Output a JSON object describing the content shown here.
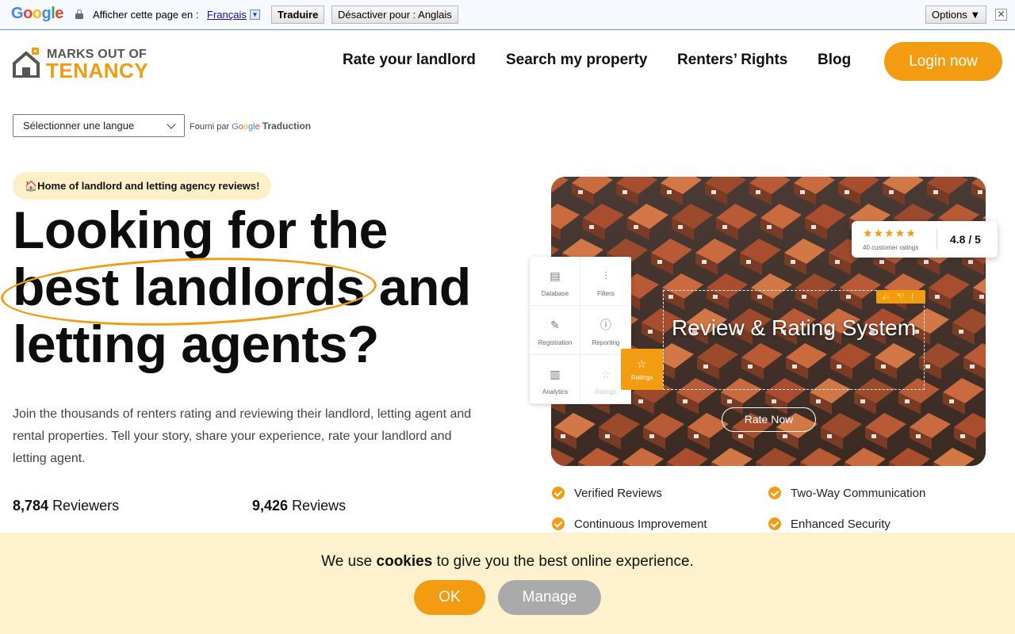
{
  "translate_bar": {
    "logo": [
      "G",
      "o",
      "o",
      "g",
      "l",
      "e"
    ],
    "prompt": "Afficher cette page en :",
    "language": "Français",
    "translate_button": "Traduire",
    "disable_button": "Désactiver pour : Anglais",
    "options_button": "Options ▼",
    "close": "✕"
  },
  "header": {
    "logo_top": "MARKS OUT OF",
    "logo_bottom": "TENANCY",
    "nav": [
      "Rate your landlord",
      "Search my property",
      "Renters’ Rights",
      "Blog"
    ],
    "login": "Login now"
  },
  "language_select": {
    "value": "Sélectionner une langue",
    "powered_prefix": "Fourni par",
    "powered_google": [
      "G",
      "o",
      "o",
      "g",
      "l",
      "e"
    ],
    "powered_suffix": "Traduction"
  },
  "hero": {
    "pill": "🏠Home of landlord and letting agency reviews!",
    "headline_line1": "Looking for the",
    "headline_line2": "best landlords and",
    "headline_line3": "letting agents?",
    "description": "Join the thousands of renters rating and reviewing their landlord, letting agent and rental properties. Tell your story, share your experience, rate your landlord and letting agent.",
    "stats": [
      {
        "value": "8,784",
        "label": "Reviewers"
      },
      {
        "value": "9,426",
        "label": "Reviews"
      }
    ]
  },
  "showcase": {
    "rating_stars": "★★★★★",
    "rating_caption": "40 customer ratings",
    "rating_score": "4.8 / 5",
    "features": [
      {
        "label": "Database",
        "icon": "database-icon"
      },
      {
        "label": "Filters",
        "icon": "filters-icon"
      },
      {
        "label": "Registration",
        "icon": "registration-icon"
      },
      {
        "label": "Reporting",
        "icon": "reporting-icon"
      },
      {
        "label": "Analytics",
        "icon": "analytics-icon"
      },
      {
        "label": "Ratings",
        "icon": "star-icon"
      }
    ],
    "active_feature": "Ratings",
    "title": "Review & Rating System",
    "rate_now": "Rate Now",
    "mini_icons": "👍👎!"
  },
  "checklist": [
    "Verified Reviews",
    "Two-Way Communication",
    "Continuous Improvement",
    "Enhanced Security"
  ],
  "cookie": {
    "text_before": "We use",
    "text_bold": "cookies",
    "text_after": "to give you the best online experience.",
    "ok": "OK",
    "manage": "Manage"
  },
  "colors": {
    "accent": "#f39c12",
    "cookie_bg": "#fdf2cd",
    "pill_bg": "#fdf0c9"
  }
}
